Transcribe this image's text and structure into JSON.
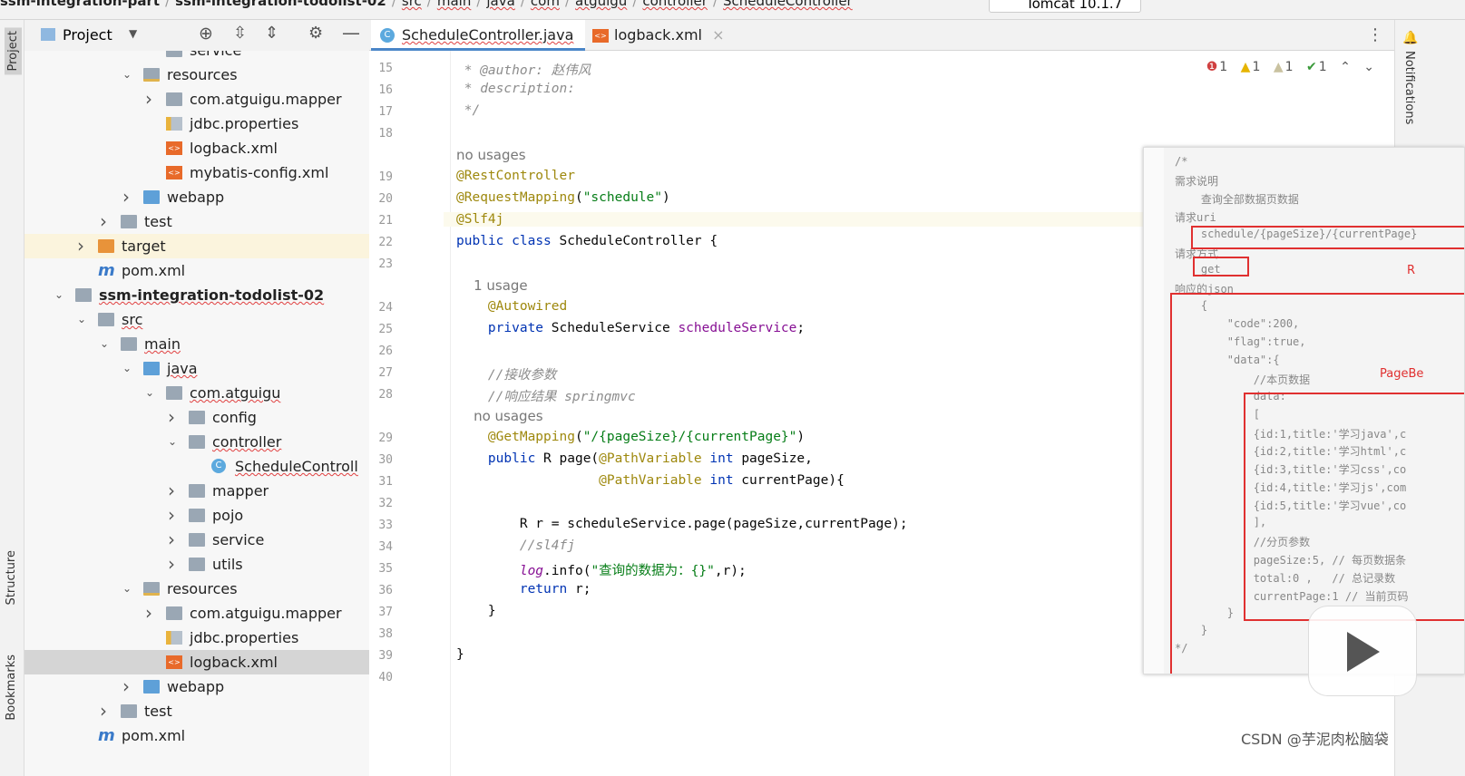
{
  "breadcrumb": [
    "ssm-integration-part",
    "ssm-integration-todolist-02",
    "src",
    "main",
    "java",
    "com",
    "atguigu",
    "controller",
    "ScheduleController"
  ],
  "toolbar": {
    "run_config": "Tomcat 10.1.7"
  },
  "left_stripe": {
    "project": "Project",
    "structure": "Structure",
    "bookmarks": "Bookmarks"
  },
  "right_stripe": {
    "notifications": "Notifications"
  },
  "project_panel": {
    "title": "Project"
  },
  "tree": [
    {
      "label": "service",
      "indent": 4,
      "arrow": "",
      "icon": "fold"
    },
    {
      "label": "resources",
      "indent": 3,
      "arrow": "down",
      "icon": "res"
    },
    {
      "label": "com.atguigu.mapper",
      "indent": 4,
      "arrow": "right",
      "icon": "fold"
    },
    {
      "label": "jdbc.properties",
      "indent": 4,
      "arrow": "",
      "icon": "prop"
    },
    {
      "label": "logback.xml",
      "indent": 4,
      "arrow": "",
      "icon": "xml"
    },
    {
      "label": "mybatis-config.xml",
      "indent": 4,
      "arrow": "",
      "icon": "xml"
    },
    {
      "label": "webapp",
      "indent": 3,
      "arrow": "right",
      "icon": "blue"
    },
    {
      "label": "test",
      "indent": 2,
      "arrow": "right",
      "icon": "fold"
    },
    {
      "label": "target",
      "indent": 1,
      "arrow": "right",
      "icon": "orange",
      "hl": true
    },
    {
      "label": "pom.xml",
      "indent": 1,
      "arrow": "",
      "icon": "mvn"
    },
    {
      "label": "ssm-integration-todolist-02",
      "indent": 0,
      "arrow": "down",
      "icon": "fold",
      "bold": true
    },
    {
      "label": "src",
      "indent": 1,
      "arrow": "down",
      "icon": "fold"
    },
    {
      "label": "main",
      "indent": 2,
      "arrow": "down",
      "icon": "fold"
    },
    {
      "label": "java",
      "indent": 3,
      "arrow": "down",
      "icon": "blue"
    },
    {
      "label": "com.atguigu",
      "indent": 4,
      "arrow": "down",
      "icon": "fold"
    },
    {
      "label": "config",
      "indent": 5,
      "arrow": "right",
      "icon": "fold"
    },
    {
      "label": "controller",
      "indent": 5,
      "arrow": "down",
      "icon": "fold"
    },
    {
      "label": "ScheduleControll",
      "indent": 6,
      "arrow": "",
      "icon": "cls"
    },
    {
      "label": "mapper",
      "indent": 5,
      "arrow": "right",
      "icon": "fold"
    },
    {
      "label": "pojo",
      "indent": 5,
      "arrow": "right",
      "icon": "fold"
    },
    {
      "label": "service",
      "indent": 5,
      "arrow": "right",
      "icon": "fold"
    },
    {
      "label": "utils",
      "indent": 5,
      "arrow": "right",
      "icon": "fold"
    },
    {
      "label": "resources",
      "indent": 3,
      "arrow": "down",
      "icon": "res"
    },
    {
      "label": "com.atguigu.mapper",
      "indent": 4,
      "arrow": "right",
      "icon": "fold"
    },
    {
      "label": "jdbc.properties",
      "indent": 4,
      "arrow": "",
      "icon": "prop"
    },
    {
      "label": "logback.xml",
      "indent": 4,
      "arrow": "",
      "icon": "xml",
      "sel": true
    },
    {
      "label": "webapp",
      "indent": 3,
      "arrow": "right",
      "icon": "blue"
    },
    {
      "label": "test",
      "indent": 2,
      "arrow": "right",
      "icon": "fold"
    },
    {
      "label": "pom.xml",
      "indent": 1,
      "arrow": "",
      "icon": "mvn"
    }
  ],
  "tabs": [
    {
      "label": "ScheduleController.java",
      "active": true
    },
    {
      "label": "logback.xml",
      "active": false
    }
  ],
  "inspections": {
    "errors": "1",
    "warnings": "1",
    "weak_warnings": "1",
    "typos": "1"
  },
  "code": [
    {
      "n": "15",
      "t": " * @author: 赵伟风"
    },
    {
      "n": "16",
      "t": " * description:"
    },
    {
      "n": "17",
      "t": " */"
    },
    {
      "n": "18",
      "t": ""
    },
    {
      "n": "",
      "t": "no usages",
      "hint": true
    },
    {
      "n": "19",
      "t": "@RestController"
    },
    {
      "n": "20",
      "t": "@RequestMapping(\"schedule\")"
    },
    {
      "n": "21",
      "t": "@Slf4j",
      "cur": true
    },
    {
      "n": "22",
      "t": "public class ScheduleController {"
    },
    {
      "n": "23",
      "t": ""
    },
    {
      "n": "",
      "t": "    1 usage",
      "hint": true
    },
    {
      "n": "24",
      "t": "    @Autowired"
    },
    {
      "n": "25",
      "t": "    private ScheduleService scheduleService;"
    },
    {
      "n": "26",
      "t": ""
    },
    {
      "n": "27",
      "t": "    //接收参数"
    },
    {
      "n": "28",
      "t": "    //响应结果 springmvc"
    },
    {
      "n": "",
      "t": "    no usages",
      "hint": true
    },
    {
      "n": "29",
      "t": "    @GetMapping(\"/{pageSize}/{currentPage}\")"
    },
    {
      "n": "30",
      "t": "    public R page(@PathVariable int pageSize,"
    },
    {
      "n": "31",
      "t": "                  @PathVariable int currentPage){"
    },
    {
      "n": "32",
      "t": ""
    },
    {
      "n": "33",
      "t": "        R r = scheduleService.page(pageSize,currentPage);"
    },
    {
      "n": "34",
      "t": "        //sl4fj"
    },
    {
      "n": "35",
      "t": "        log.info(\"查询的数据为：{}\",r);"
    },
    {
      "n": "36",
      "t": "        return r;"
    },
    {
      "n": "37",
      "t": "    }"
    },
    {
      "n": "38",
      "t": ""
    },
    {
      "n": "39",
      "t": "}"
    },
    {
      "n": "40",
      "t": ""
    }
  ],
  "popup": [
    "/*",
    "需求说明",
    "    查询全部数据页数据",
    "请求uri",
    "    schedule/{pageSize}/{currentPage}",
    "请求方式",
    "    get",
    "响应的json",
    "    {",
    "        \"code\":200,",
    "        \"flag\":true,",
    "        \"data\":{",
    "            //本页数据",
    "            data:",
    "            [",
    "            {id:1,title:'学习java',c",
    "            {id:2,title:'学习html',c",
    "            {id:3,title:'学习css',co",
    "            {id:4,title:'学习js',com",
    "            {id:5,title:'学习vue',co",
    "            ],",
    "            //分页参数",
    "            pageSize:5, // 每页数据条",
    "            total:0 ,   // 总记录数",
    "            currentPage:1 // 当前页码",
    "        }",
    "    }",
    "*/"
  ],
  "popup_annotations": {
    "r": "R",
    "pagebean": "PageBe"
  },
  "watermark": "CSDN @芋泥肉松脑袋",
  "colors": {
    "accent": "#4a86c8",
    "annotation": "#9e880d",
    "keyword": "#0033b3",
    "string": "#067d17",
    "highlight_box": "#e03030"
  }
}
